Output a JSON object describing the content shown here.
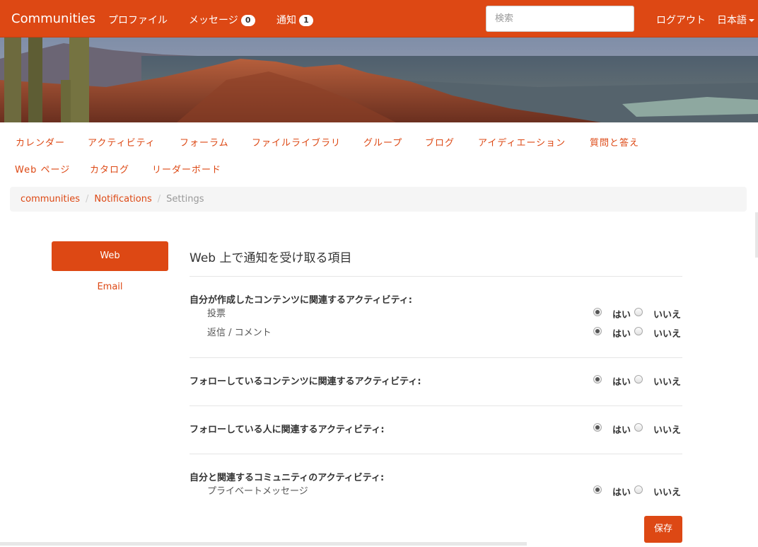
{
  "navbar": {
    "brand": "Communities",
    "items": [
      {
        "label": "プロファイル"
      },
      {
        "label": "メッセージ",
        "badge": "0"
      },
      {
        "label": "通知",
        "badge": "1"
      }
    ],
    "search_placeholder": "検索",
    "logout": "ログアウト",
    "language": "日本語"
  },
  "subnav": {
    "row1": [
      "カレンダー",
      "アクティビティ",
      "フォーラム",
      "ファイルライブラリ",
      "グループ",
      "ブログ",
      "アイディエーション",
      "質問と答え"
    ],
    "row2": [
      "Web ページ",
      "カタログ",
      "リーダーボード"
    ]
  },
  "breadcrumb": {
    "items": [
      "communities",
      "Notifications"
    ],
    "active": "Settings",
    "separator": "/"
  },
  "sidebar": {
    "web": "Web",
    "email": "Email"
  },
  "main": {
    "heading": "Web 上で通知を受け取る項目",
    "yes": "はい",
    "no": "いいえ",
    "sections": [
      {
        "title": "自分が作成したコンテンツに関連するアクティビティ:",
        "rows": [
          {
            "label": "投票",
            "value": "yes"
          },
          {
            "label": "返信 / コメント",
            "value": "yes"
          }
        ]
      },
      {
        "title": "フォローしているコンテンツに関連するアクティビティ:",
        "value": "yes"
      },
      {
        "title": "フォローしている人に関連するアクティビティ:",
        "value": "yes"
      },
      {
        "title": "自分と関連するコミュニティのアクティビティ:",
        "rows": [
          {
            "label": "プライベートメッセージ",
            "value": "yes"
          }
        ]
      }
    ],
    "save": "保存"
  },
  "colors": {
    "accent": "#dd4814",
    "breadcrumb_bg": "#f5f5f5"
  }
}
